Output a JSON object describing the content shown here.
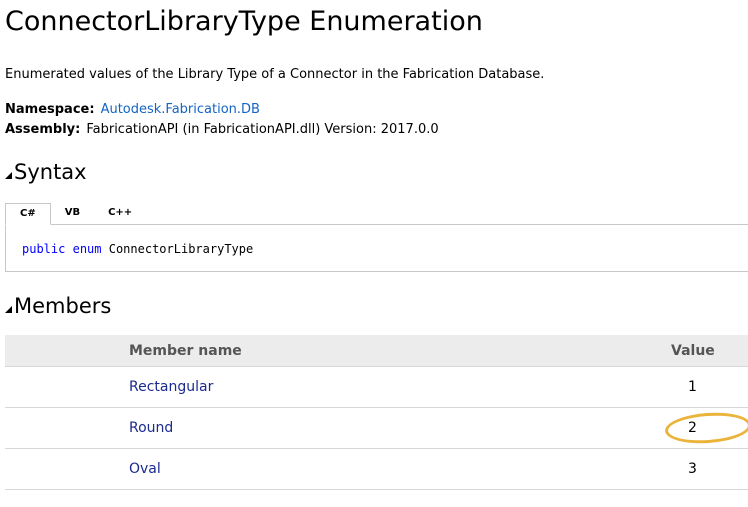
{
  "page": {
    "title": "ConnectorLibraryType Enumeration",
    "summary": "Enumerated values of the Library Type of a Connector in the Fabrication Database.",
    "namespace_label": "Namespace:",
    "namespace_value": "Autodesk.Fabrication.DB",
    "assembly_label": "Assembly:",
    "assembly_value": "FabricationAPI (in FabricationAPI.dll) Version: 2017.0.0"
  },
  "syntax": {
    "heading": "Syntax",
    "tabs": [
      {
        "label": "C#",
        "active": true
      },
      {
        "label": "VB",
        "active": false
      },
      {
        "label": "C++",
        "active": false
      }
    ],
    "code": {
      "kw1": "public",
      "kw2": "enum",
      "name": "ConnectorLibraryType"
    }
  },
  "members": {
    "heading": "Members",
    "columns": {
      "name": "Member name",
      "value": "Value"
    },
    "rows": [
      {
        "name": "Rectangular",
        "value": "1",
        "highlighted": false
      },
      {
        "name": "Round",
        "value": "2",
        "highlighted": true
      },
      {
        "name": "Oval",
        "value": "3",
        "highlighted": false
      }
    ]
  },
  "colors": {
    "link": "#1364c4",
    "member_link": "#1b2a8f",
    "keyword": "#0000ff",
    "highlight": "#eab33a",
    "table_header_bg": "#ececec"
  }
}
